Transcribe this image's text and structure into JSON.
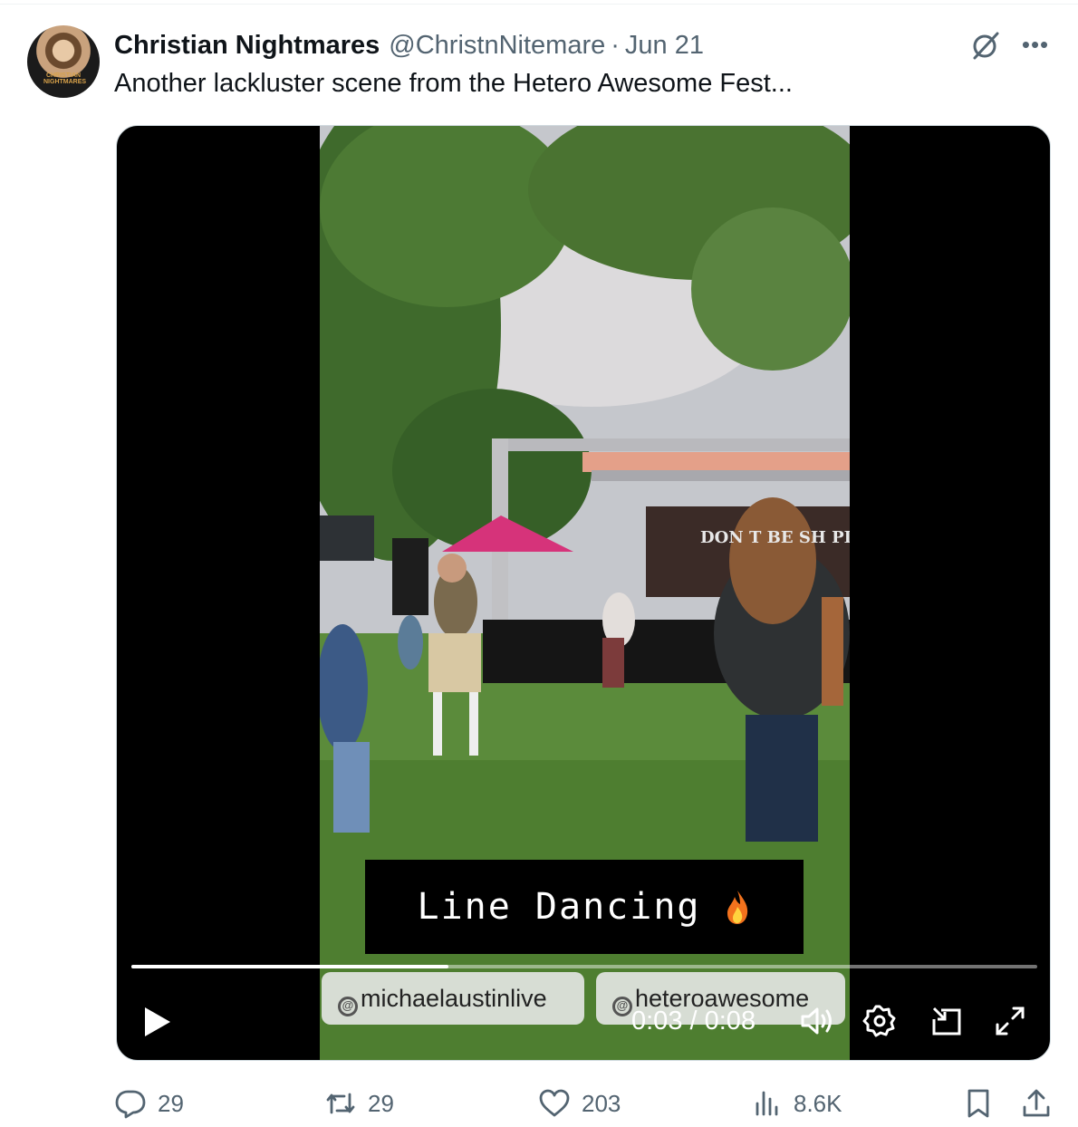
{
  "tweet": {
    "author_name": "Christian Nightmares",
    "handle": "@ChristnNitemare",
    "separator": "·",
    "date": "Jun 21",
    "text": "Another lackluster scene from the Hetero Awesome Fest...",
    "avatar_shirt_text": "CHRISTIAN NIGHTMARES"
  },
  "header_icons": [
    "grok-icon",
    "more-icon"
  ],
  "video": {
    "caption": "Line Dancing",
    "caption_emoji_icon": "fire-icon",
    "stage_banner": "DON T BE SH PL",
    "tags": [
      "michaelaustinlive",
      "heteroawesome"
    ],
    "current_time": "0:03",
    "time_separator": " / ",
    "duration": "0:08",
    "progress_fraction": 0.35,
    "controls": [
      "play-icon",
      "volume-icon",
      "settings-icon",
      "pip-icon",
      "fullscreen-icon"
    ]
  },
  "actions": {
    "replies": "29",
    "reposts": "29",
    "likes": "203",
    "views": "8.6K"
  },
  "colors": {
    "text_primary": "#0f1419",
    "text_secondary": "#536471",
    "media_background": "#000000"
  }
}
